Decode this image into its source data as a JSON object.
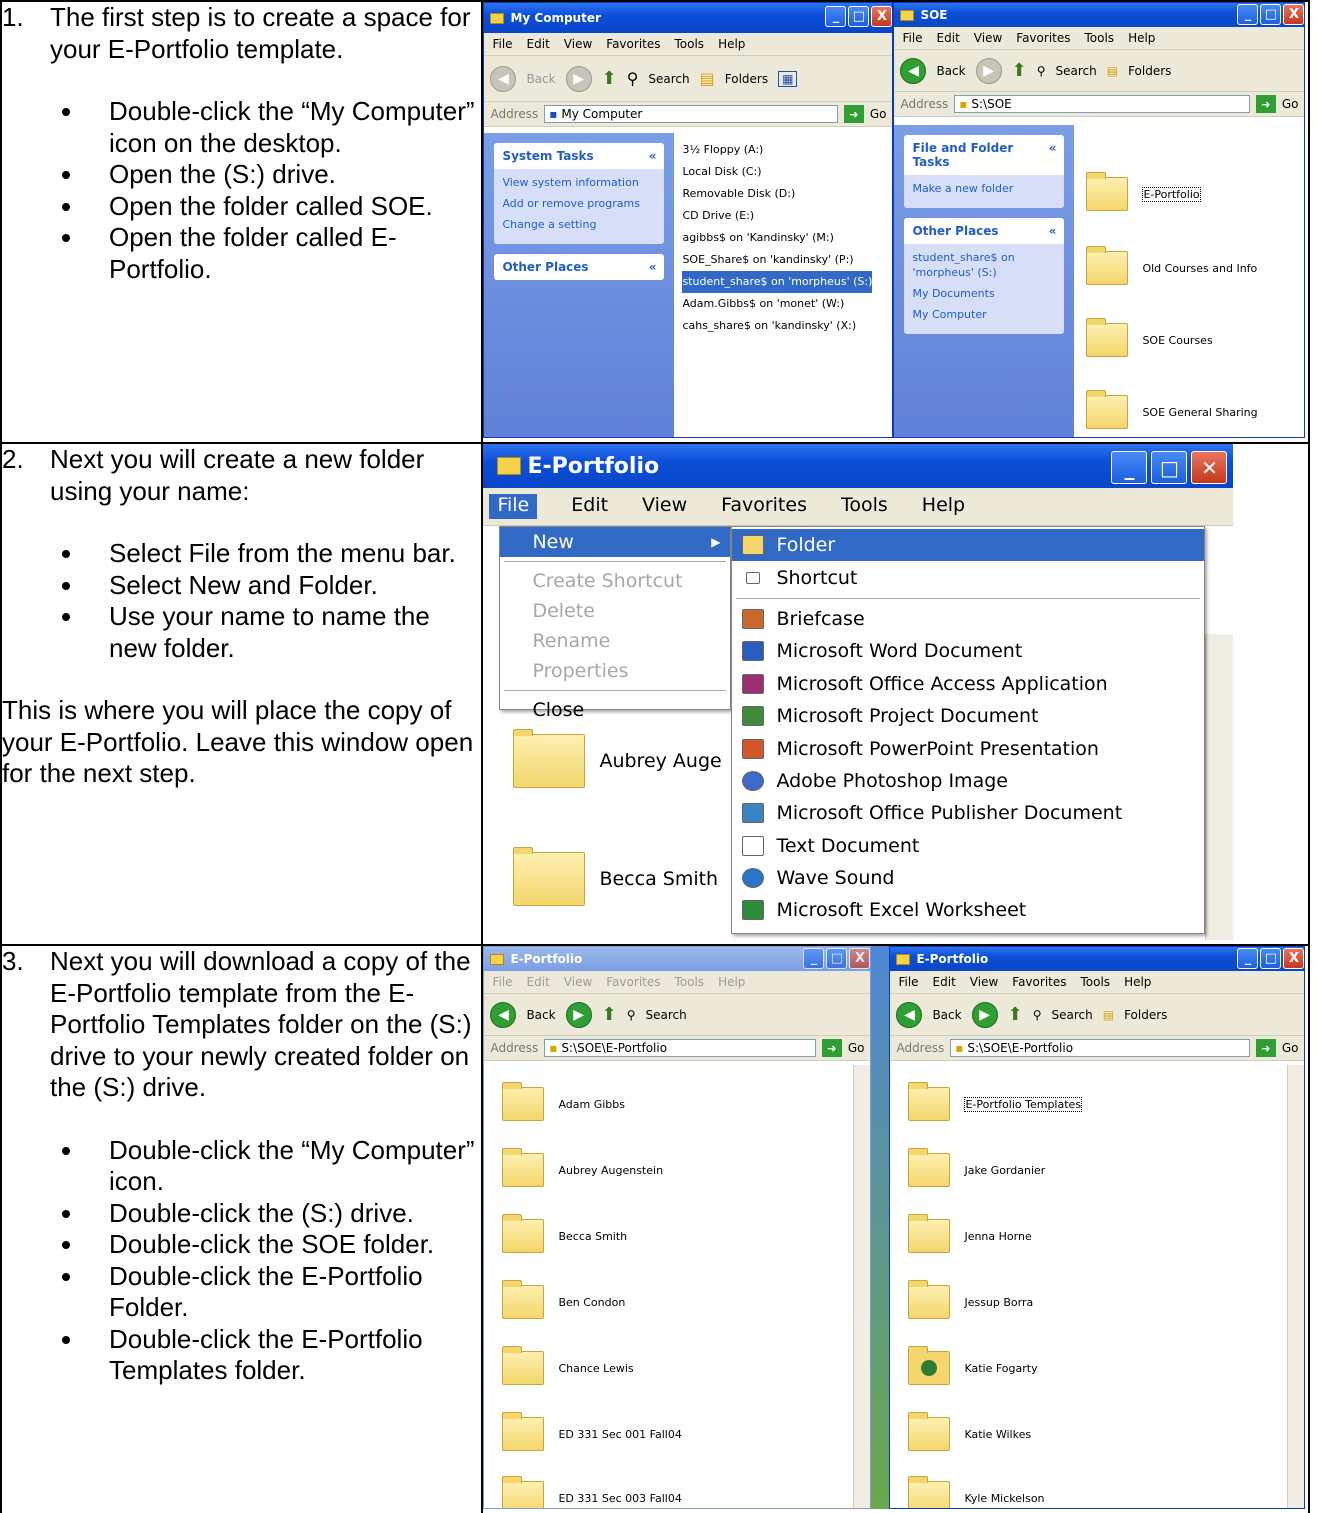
{
  "steps": [
    {
      "num": "1.",
      "intro": "The first step is to create a space for your E-Portfolio template.",
      "bullets": [
        "Double-click the “My Computer” icon on the desktop.",
        "Open the (S:) drive.",
        "Open the folder called SOE.",
        "Open the folder called E-Portfolio."
      ],
      "outro": ""
    },
    {
      "num": "2.",
      "intro": "Next you will create a new folder using your name:",
      "bullets": [
        "Select File from the menu bar.",
        "Select New and Folder.",
        "Use your name to name the new folder."
      ],
      "outro": "This is where you will place the copy of your E-Portfolio.  Leave this window open for the next step."
    },
    {
      "num": "3.",
      "intro": "Next you will download a copy of the E-Portfolio template from the E-Portfolio Templates folder on the (S:) drive to your newly created folder on the (S:) drive.",
      "bullets": [
        "Double-click the “My Computer” icon.",
        "Double-click the (S:) drive.",
        "Double-click the SOE folder.",
        "Double-click the E-Portfolio Folder.",
        "Double-click the E-Portfolio Templates folder."
      ],
      "outro": ""
    }
  ],
  "shot1": {
    "mycomp": {
      "title": "My Computer",
      "menu": [
        "File",
        "Edit",
        "View",
        "Favorites",
        "Tools",
        "Help"
      ],
      "toolbar": {
        "back": "Back",
        "search": "Search",
        "folders": "Folders"
      },
      "address_label": "Address",
      "address_value": "My Computer",
      "go": "Go",
      "system_tasks": "System Tasks",
      "tasks": [
        "View system information",
        "Add or remove programs",
        "Change a setting"
      ],
      "other_places": "Other Places",
      "drives": [
        "3½ Floppy (A:)",
        "Local Disk (C:)",
        "Removable Disk (D:)",
        "CD Drive (E:)",
        "agibbs$ on 'Kandinsky' (M:)",
        "SOE_Share$ on 'kandinsky' (P:)",
        "student_share$ on 'morpheus' (S:)",
        "Adam.Gibbs$ on 'monet' (W:)",
        "cahs_share$ on 'kandinsky' (X:)"
      ]
    },
    "soe": {
      "title": "SOE",
      "menu": [
        "File",
        "Edit",
        "View",
        "Favorites",
        "Tools",
        "Help"
      ],
      "toolbar": {
        "back": "Back",
        "search": "Search",
        "folders": "Folders"
      },
      "address_label": "Address",
      "address_value": "S:\\SOE",
      "go": "Go",
      "file_tasks": "File and Folder Tasks",
      "make_folder": "Make a new folder",
      "other_places": "Other Places",
      "places": [
        "student_share$ on 'morpheus' (S:)",
        "My Documents",
        "My Computer"
      ],
      "folders": [
        "E-Portfolio",
        "Old Courses and Info",
        "SOE Courses",
        "SOE General Sharing"
      ]
    }
  },
  "shot2": {
    "title": "E-Portfolio",
    "menu": [
      "File",
      "Edit",
      "View",
      "Favorites",
      "Tools",
      "Help"
    ],
    "file_menu": [
      "New",
      "Create Shortcut",
      "Delete",
      "Rename",
      "Properties",
      "Close"
    ],
    "new_menu": [
      "Folder",
      "Shortcut",
      "Briefcase",
      "Microsoft Word Document",
      "Microsoft Office Access Application",
      "Microsoft Project Document",
      "Microsoft PowerPoint Presentation",
      "Adobe Photoshop Image",
      "Microsoft Office Publisher Document",
      "Text Document",
      "Wave Sound",
      "Microsoft Excel Worksheet"
    ],
    "bg_folders": [
      "Aubrey Auge",
      "Becca Smith"
    ]
  },
  "shot3": {
    "left": {
      "title": "E-Portfolio",
      "menu": [
        "File",
        "Edit",
        "View",
        "Favorites",
        "Tools",
        "Help"
      ],
      "toolbar": {
        "back": "Back",
        "search": "Search"
      },
      "address_label": "Address",
      "address_value": "S:\\SOE\\E-Portfolio",
      "go": "Go",
      "folders": [
        "Adam Gibbs",
        "Aubrey Augenstein",
        "Becca Smith",
        "Ben Condon",
        "Chance Lewis",
        "ED 331 Sec 001 Fall04",
        "ED 331 Sec 003 Fall04"
      ]
    },
    "right": {
      "title": "E-Portfolio",
      "menu": [
        "File",
        "Edit",
        "View",
        "Favorites",
        "Tools",
        "Help"
      ],
      "toolbar": {
        "back": "Back",
        "search": "Search",
        "folders": "Folders"
      },
      "address_label": "Address",
      "address_value": "S:\\SOE\\E-Portfolio",
      "go": "Go",
      "folders": [
        "E-Portfolio Templates",
        "Jake Gordanier",
        "Jenna Horne",
        "Jessup Borra",
        "Katie Fogarty",
        "Katie Wilkes",
        "Kyle Mickelson"
      ]
    }
  }
}
